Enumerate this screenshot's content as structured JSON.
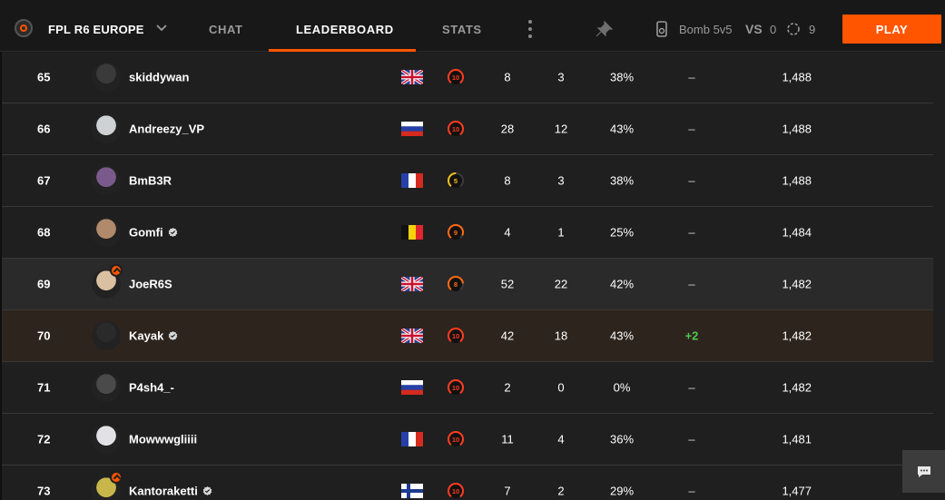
{
  "header": {
    "hub_name": "FPL R6 EUROPE",
    "tabs": [
      {
        "label": "CHAT"
      },
      {
        "label": "LEADERBOARD"
      },
      {
        "label": "STATS"
      }
    ],
    "mode_label": "Bomb 5v5",
    "vs_label": "VS",
    "vs_count": "0",
    "queue_count": "9",
    "play_label": "PLAY"
  },
  "colors": {
    "accent": "#ff5500",
    "level_high": "#ff3b1f",
    "level_mid": "#ff6a13",
    "level_low": "#f2c318",
    "positive": "#4ec94e"
  },
  "leaderboard": {
    "rows": [
      {
        "rank": "65",
        "name": "skiddywan",
        "verified": false,
        "badge": false,
        "flag": "gb",
        "level": "10",
        "matches": "8",
        "wins": "3",
        "winrate": "38%",
        "change": "–",
        "elo": "1,488",
        "state": "normal",
        "avatar": "#3a3a3a"
      },
      {
        "rank": "66",
        "name": "Andreezy_VP",
        "verified": false,
        "badge": false,
        "flag": "ru",
        "level": "10",
        "matches": "28",
        "wins": "12",
        "winrate": "43%",
        "change": "–",
        "elo": "1,488",
        "state": "normal",
        "avatar": "#cfd2d4"
      },
      {
        "rank": "67",
        "name": "BmB3R",
        "verified": false,
        "badge": false,
        "flag": "fr",
        "level": "5",
        "matches": "8",
        "wins": "3",
        "winrate": "38%",
        "change": "–",
        "elo": "1,488",
        "state": "normal",
        "avatar": "#7a5a8c"
      },
      {
        "rank": "68",
        "name": "Gomfi",
        "verified": true,
        "badge": false,
        "flag": "be",
        "level": "9",
        "matches": "4",
        "wins": "1",
        "winrate": "25%",
        "change": "–",
        "elo": "1,484",
        "state": "normal",
        "avatar": "#b08a6a"
      },
      {
        "rank": "69",
        "name": "JoeR6S",
        "verified": false,
        "badge": true,
        "flag": "gb",
        "level": "8",
        "matches": "52",
        "wins": "22",
        "winrate": "42%",
        "change": "–",
        "elo": "1,482",
        "state": "hover",
        "avatar": "#d9c0a0"
      },
      {
        "rank": "70",
        "name": "Kayak",
        "verified": true,
        "badge": false,
        "flag": "gb",
        "level": "10",
        "matches": "42",
        "wins": "18",
        "winrate": "43%",
        "change": "+2",
        "elo": "1,482",
        "state": "me",
        "avatar": "#2a2a2a"
      },
      {
        "rank": "71",
        "name": "P4sh4_-",
        "verified": false,
        "badge": false,
        "flag": "ru",
        "level": "10",
        "matches": "2",
        "wins": "0",
        "winrate": "0%",
        "change": "–",
        "elo": "1,482",
        "state": "normal",
        "avatar": "#4a4a4a"
      },
      {
        "rank": "72",
        "name": "Mowwwgliiii",
        "verified": false,
        "badge": false,
        "flag": "fr",
        "level": "10",
        "matches": "11",
        "wins": "4",
        "winrate": "36%",
        "change": "–",
        "elo": "1,481",
        "state": "normal",
        "avatar": "#e2e2e6"
      },
      {
        "rank": "73",
        "name": "Kantoraketti",
        "verified": true,
        "badge": true,
        "flag": "fi",
        "level": "10",
        "matches": "7",
        "wins": "2",
        "winrate": "29%",
        "change": "–",
        "elo": "1,477",
        "state": "normal",
        "avatar": "#c8b64a"
      }
    ]
  },
  "icons": {
    "hub_logo": "hub-logo-icon",
    "chevron": "chevron-down-icon",
    "kebab": "kebab-menu-icon",
    "pin": "pin-icon",
    "game": "rainbow-six-icon",
    "queue": "queue-icon",
    "chat": "chat-bubble-icon"
  }
}
